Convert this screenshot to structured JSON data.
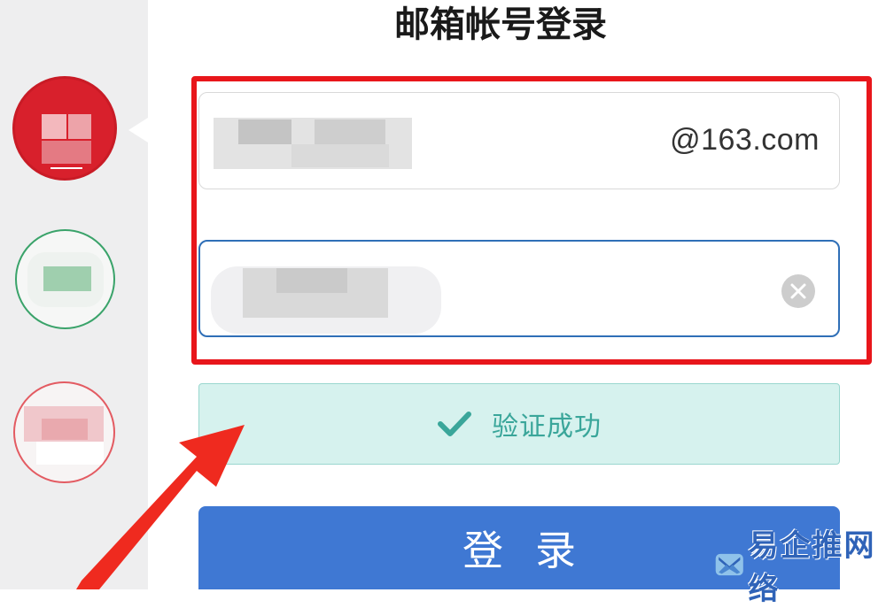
{
  "header": {
    "title": "邮箱帐号登录"
  },
  "account_field": {
    "domain_suffix": "@163.com"
  },
  "verification": {
    "status_text": "验证成功"
  },
  "login_button": {
    "label": "登录"
  },
  "watermark": {
    "text": "易企推网络"
  },
  "colors": {
    "highlight": "#e8161b",
    "primary": "#3f78d3",
    "success": "#3aa69a",
    "success_bg": "#d6f2ee",
    "provider_red": "#d8202c",
    "provider_green": "#3aa36a",
    "provider_pink": "#e35b62"
  },
  "icons": {
    "clear": "clear-circle-x-icon",
    "success": "checkmark-icon",
    "pointer": "red-arrow-annotation"
  }
}
